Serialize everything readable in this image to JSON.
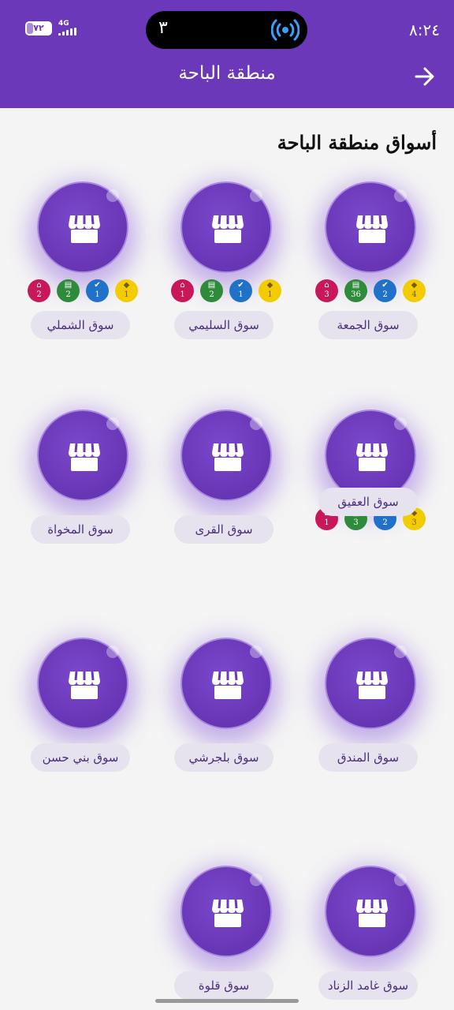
{
  "status": {
    "time": "٨:٢٤",
    "battery": "٧٢",
    "network": "4G",
    "island_count": "٣"
  },
  "header": {
    "title": "منطقة الباحة",
    "back_icon": "arrow-right-icon"
  },
  "section_title": "أسواق منطقة الباحة",
  "markets": [
    {
      "name": "سوق الجمعة",
      "badges": [
        "3",
        "36",
        "2",
        "4"
      ]
    },
    {
      "name": "سوق السليمي",
      "badges": [
        "1",
        "2",
        "1",
        "1"
      ]
    },
    {
      "name": "سوق الشملي",
      "badges": [
        "2",
        "2",
        "1",
        "1"
      ]
    },
    {
      "name": "سوق العقيق",
      "badges": [
        "1",
        "3",
        "2",
        "3"
      ]
    },
    {
      "name": "سوق القرى",
      "badges": []
    },
    {
      "name": "سوق المخواة",
      "badges": []
    },
    {
      "name": "سوق المندق",
      "badges": []
    },
    {
      "name": "سوق بلجرشي",
      "badges": []
    },
    {
      "name": "سوق بني حسن",
      "badges": []
    },
    {
      "name": "سوق غامد الزناد",
      "badges": []
    },
    {
      "name": "سوق قلوة",
      "badges": []
    }
  ],
  "badge_types": [
    {
      "icon": "home-icon",
      "color": "#c8185a"
    },
    {
      "icon": "store-icon",
      "color": "#2e8b3a"
    },
    {
      "icon": "verified-icon",
      "color": "#1f72c8"
    },
    {
      "icon": "diamond-icon",
      "color": "#f3cc00"
    }
  ],
  "colors": {
    "primary": "#6a38b8",
    "label_bg": "#e6e2ee"
  }
}
